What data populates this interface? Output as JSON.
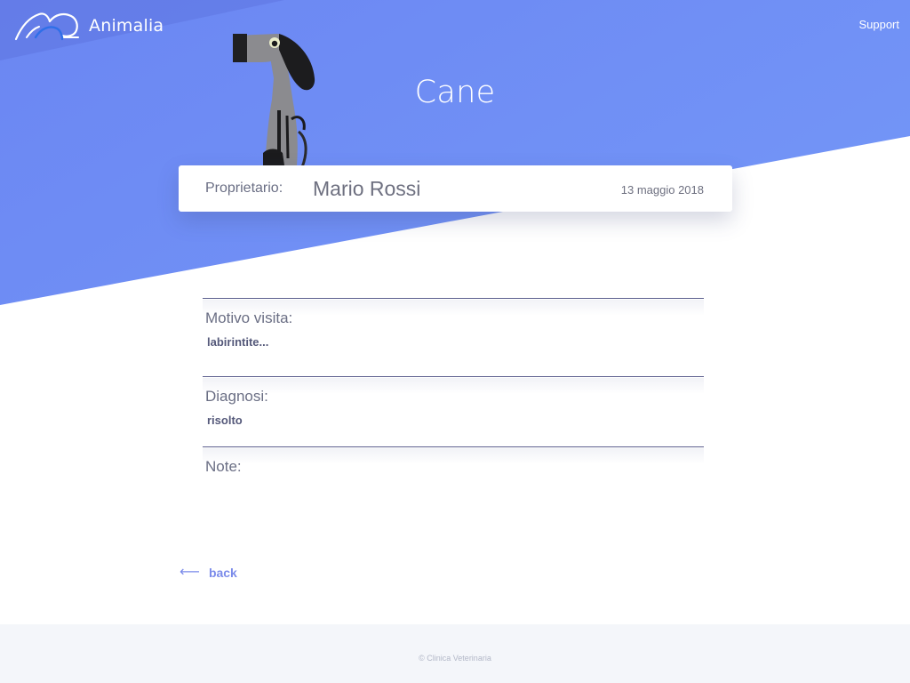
{
  "header": {
    "app_name": "Animalia",
    "support_label": "Support"
  },
  "page": {
    "title": "Cane"
  },
  "owner_card": {
    "label": "Proprietario:",
    "name": "Mario Rossi",
    "date": "13 maggio 2018"
  },
  "visit": {
    "reason_label": "Motivo visita:",
    "reason_value": "labirintite...",
    "diagnosis_label": "Diagnosi:",
    "diagnosis_value": "risolto",
    "notes_label": "Note:",
    "notes_value": ""
  },
  "navigation": {
    "back_arrow": "⟵",
    "back_label": "back"
  },
  "footer": {
    "copyright": "© Clinica Veterinaria"
  },
  "colors": {
    "hero_blue": "#6c8cf5",
    "accent": "#7b8bea",
    "footer_bg": "#f4f6fa"
  },
  "icons": {
    "logo": "cat-dog-outline-logo-icon",
    "back": "arrow-left-icon",
    "dog": "sitting-dog-illustration"
  }
}
